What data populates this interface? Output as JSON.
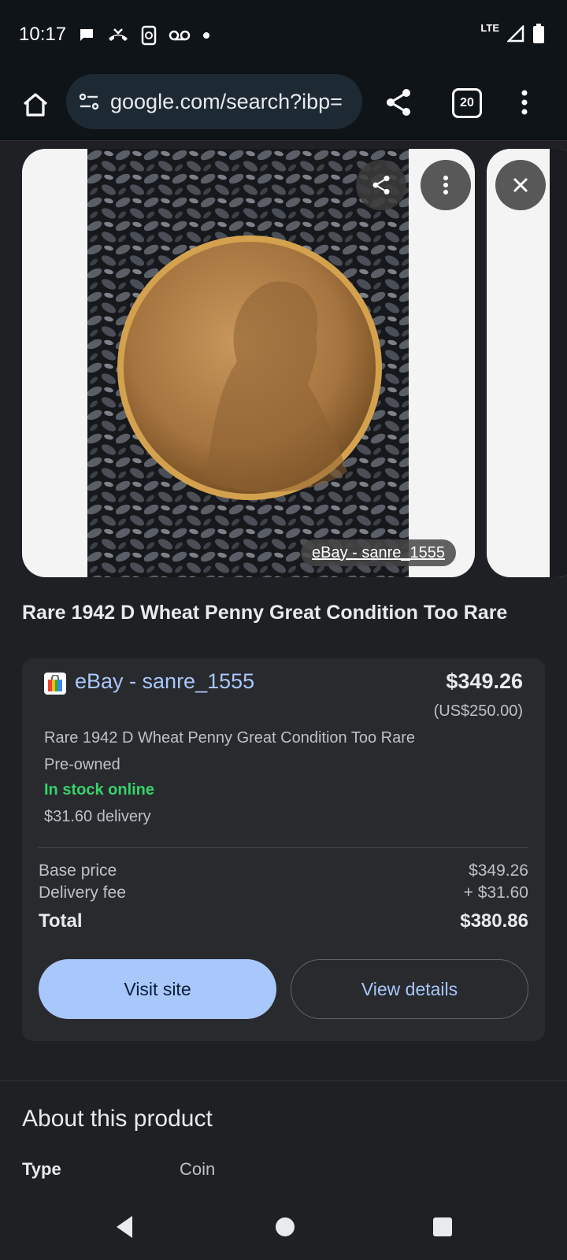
{
  "status_bar": {
    "time": "10:17",
    "network": "LTE"
  },
  "toolbar": {
    "url": "google.com/search?ibp=",
    "tab_count": "20"
  },
  "carousel": {
    "source_badge": "eBay - sanre_1555"
  },
  "product": {
    "title": "Rare 1942 D Wheat Penny Great Condition Too Rare"
  },
  "offer": {
    "store": "eBay - sanre_1555",
    "price": "$349.26",
    "price_original": "(US$250.00)",
    "description": "Rare 1942 D Wheat Penny Great Condition Too Rare",
    "condition": "Pre-owned",
    "stock": "In stock online",
    "delivery": "$31.60 delivery",
    "base_price_label": "Base price",
    "base_price": "$349.26",
    "delivery_fee_label": "Delivery fee",
    "delivery_fee": "+ $31.60",
    "total_label": "Total",
    "total": "$380.86",
    "visit_label": "Visit site",
    "details_label": "View details"
  },
  "about": {
    "title": "About this product",
    "rows": [
      {
        "label": "Type",
        "value": "Coin"
      }
    ]
  },
  "colors": {
    "accent": "#a8c7fa",
    "in_stock": "#34d36b",
    "background": "#1f2023"
  }
}
